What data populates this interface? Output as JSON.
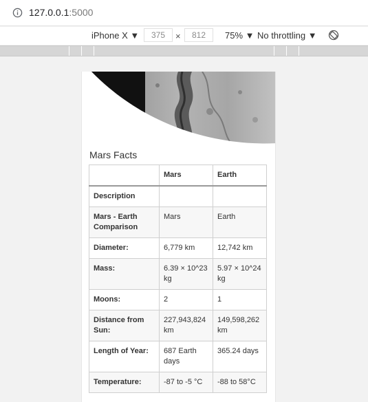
{
  "browser": {
    "url_host": "127.0.0.1",
    "url_port": ":5000"
  },
  "device_toolbar": {
    "device": "iPhone X ▼",
    "width": "375",
    "times": "×",
    "height": "812",
    "zoom": "75% ▼",
    "throttling": "No throttling ▼"
  },
  "page": {
    "section_title": "Mars Facts",
    "table": {
      "header": [
        "",
        "Mars",
        "Earth"
      ],
      "rows": [
        {
          "label": "Description",
          "mars": "",
          "earth": ""
        },
        {
          "label": "Mars - Earth Comparison",
          "mars": "Mars",
          "earth": "Earth"
        },
        {
          "label": "Diameter:",
          "mars": "6,779 km",
          "earth": "12,742 km"
        },
        {
          "label": "Mass:",
          "mars": "6.39 × 10^23 kg",
          "earth": "5.97 × 10^24 kg"
        },
        {
          "label": "Moons:",
          "mars": "2",
          "earth": "1"
        },
        {
          "label": "Distance from Sun:",
          "mars": "227,943,824 km",
          "earth": "149,598,262 km"
        },
        {
          "label": "Length of Year:",
          "mars": "687 Earth days",
          "earth": "365.24 days"
        },
        {
          "label": "Temperature:",
          "mars": "-87 to -5 °C",
          "earth": "-88 to 58°C"
        }
      ]
    }
  },
  "icons": {
    "info": "info-icon",
    "rotate": "rotate-icon"
  }
}
